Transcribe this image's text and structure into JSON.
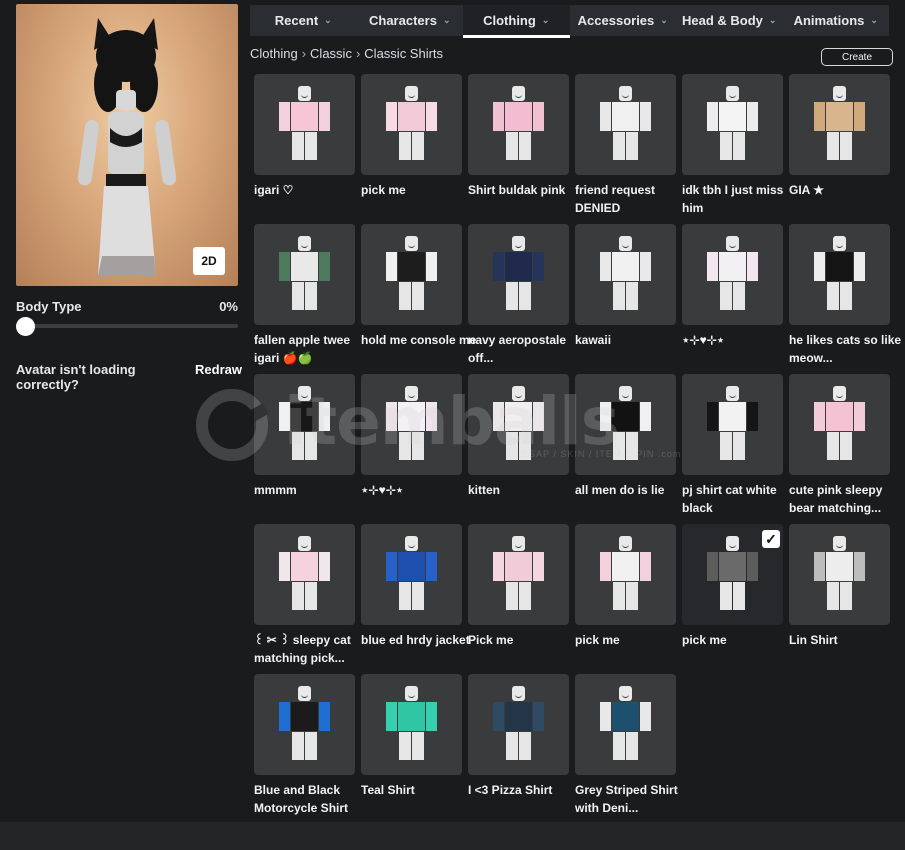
{
  "avatar": {
    "view_toggle_label": "2D"
  },
  "body_type": {
    "label": "Body Type",
    "value": "0%",
    "level": 0
  },
  "redraw": {
    "prompt": "Avatar isn't loading correctly?",
    "link_label": "Redraw"
  },
  "tabs": [
    {
      "label": "Recent",
      "active": false
    },
    {
      "label": "Characters",
      "active": false
    },
    {
      "label": "Clothing",
      "active": true
    },
    {
      "label": "Accessories",
      "active": false
    },
    {
      "label": "Head & Body",
      "active": false
    },
    {
      "label": "Animations",
      "active": false
    }
  ],
  "breadcrumb": [
    "Clothing",
    "Classic",
    "Classic Shirts"
  ],
  "create_label": "Create",
  "watermark": {
    "text": "itemballs",
    "sub": "ESAP / SKIN / ITEM-E-PIN .com"
  },
  "items": [
    {
      "name": "igari ♡",
      "colors": [
        "#f6c5d6",
        "#f3d0dd"
      ]
    },
    {
      "name": "pick me",
      "colors": [
        "#f2c9d6",
        "#f6dbe4"
      ]
    },
    {
      "name": "Shirt buldak pink",
      "colors": [
        "#f3bcd0",
        "#f1c1d2"
      ]
    },
    {
      "name": "friend request DENIED",
      "colors": [
        "#f0f0f0",
        "#e8e8e8"
      ]
    },
    {
      "name": "idk tbh I just miss him",
      "colors": [
        "#f4f4f4",
        "#ececec"
      ]
    },
    {
      "name": "GIA ★",
      "colors": [
        "#d8b58d",
        "#cfa87c"
      ]
    },
    {
      "name": "fallen apple twee igari 🍎🍏",
      "colors": [
        "#e9e9e9",
        "#4d7a5d"
      ]
    },
    {
      "name": "hold me console me",
      "colors": [
        "#1d1d1d",
        "#f0f0f0"
      ]
    },
    {
      "name": "navy aeropostale off...",
      "colors": [
        "#1f2a4c",
        "#27345a"
      ]
    },
    {
      "name": "kawaii",
      "colors": [
        "#f1f1f1",
        "#e9e9e9"
      ]
    },
    {
      "name": "⋆⊹♥⊹⋆",
      "colors": [
        "#f3f0f3",
        "#f3e6ee"
      ]
    },
    {
      "name": "he likes cats so like meow...",
      "colors": [
        "#141414",
        "#ededed"
      ]
    },
    {
      "name": "mmmm",
      "colors": [
        "#181818",
        "#f0f0f0"
      ]
    },
    {
      "name": "⋆⊹♥⊹⋆",
      "colors": [
        "#f3f1f3",
        "#efe5ec"
      ]
    },
    {
      "name": "kitten",
      "colors": [
        "#f1eef0",
        "#ebe6e9"
      ]
    },
    {
      "name": "all men do is lie",
      "colors": [
        "#121212",
        "#f0f0f0"
      ]
    },
    {
      "name": "pj shirt cat white black",
      "colors": [
        "#f2f2f2",
        "#151515"
      ]
    },
    {
      "name": "cute pink sleepy bear matching...",
      "colors": [
        "#f5c2d3",
        "#f3cbd8"
      ]
    },
    {
      "name": "꒰ ✂ ꒱ sleepy cat matching pick...",
      "colors": [
        "#f6d2de",
        "#f0e7eb"
      ]
    },
    {
      "name": "blue ed hrdy jacket",
      "colors": [
        "#1e4fae",
        "#2660c8"
      ]
    },
    {
      "name": "Pick me",
      "colors": [
        "#f0cbd8",
        "#f4d6e1"
      ]
    },
    {
      "name": "pick me",
      "colors": [
        "#f1f1f1",
        "#f2d0dc"
      ]
    },
    {
      "name": "pick me",
      "colors": [
        "#6a6a6a",
        "#5c5c5c"
      ],
      "selected": true
    },
    {
      "name": "Lin Shirt",
      "colors": [
        "#ededed",
        "#bdbdbd"
      ]
    },
    {
      "name": "Blue and Black Motorcycle Shirt",
      "colors": [
        "#1b1b1b",
        "#1f6fd2"
      ]
    },
    {
      "name": "Teal Shirt",
      "colors": [
        "#2fc6a4",
        "#35d0ad"
      ]
    },
    {
      "name": "I <3 Pizza Shirt",
      "colors": [
        "#233547",
        "#2f4a63"
      ]
    },
    {
      "name": "Grey Striped Shirt with Deni...",
      "colors": [
        "#1d4f6f",
        "#e8e8e8"
      ]
    }
  ]
}
